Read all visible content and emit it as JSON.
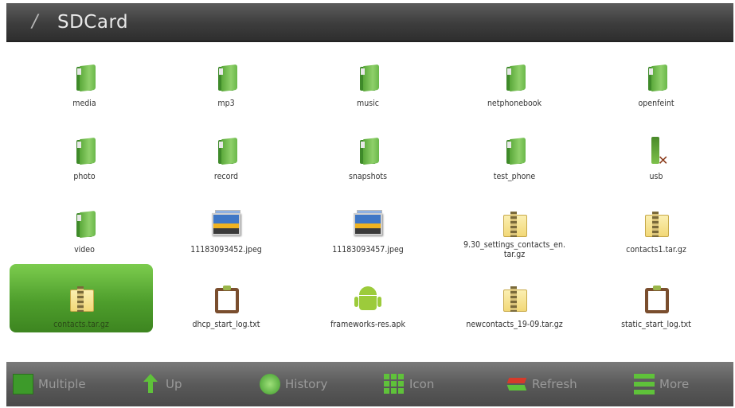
{
  "titlebar": {
    "slash": "/",
    "title": "SDCard"
  },
  "files": [
    {
      "name": "media",
      "type": "folder"
    },
    {
      "name": "mp3",
      "type": "folder"
    },
    {
      "name": "music",
      "type": "folder"
    },
    {
      "name": "netphonebook",
      "type": "folder"
    },
    {
      "name": "openfeint",
      "type": "folder"
    },
    {
      "name": "photo",
      "type": "folder"
    },
    {
      "name": "record",
      "type": "folder"
    },
    {
      "name": "snapshots",
      "type": "folder"
    },
    {
      "name": "test_phone",
      "type": "folder"
    },
    {
      "name": "usb",
      "type": "usb"
    },
    {
      "name": "video",
      "type": "folder"
    },
    {
      "name": "11183093452.jpeg",
      "type": "image"
    },
    {
      "name": "11183093457.jpeg",
      "type": "image"
    },
    {
      "name": "9.30_settings_contacts_en.tar.gz",
      "type": "archive"
    },
    {
      "name": "contacts1.tar.gz",
      "type": "archive"
    },
    {
      "name": "contacts.tar.gz",
      "type": "archive",
      "selected": true
    },
    {
      "name": "dhcp_start_log.txt",
      "type": "text"
    },
    {
      "name": "frameworks-res.apk",
      "type": "apk"
    },
    {
      "name": "newcontacts_19-09.tar.gz",
      "type": "archive"
    },
    {
      "name": "static_start_log.txt",
      "type": "text"
    }
  ],
  "toolbar": {
    "multiple": "Multiple",
    "up": "Up",
    "history": "History",
    "icon": "Icon",
    "refresh": "Refresh",
    "more": "More"
  },
  "colors": {
    "selected": "#4e9e2c",
    "titlebar": "#3d3d3d",
    "toolbar": "#5a5a5a",
    "toolbar_text": "#9a9a9a",
    "accent_green": "#5fc23a"
  }
}
